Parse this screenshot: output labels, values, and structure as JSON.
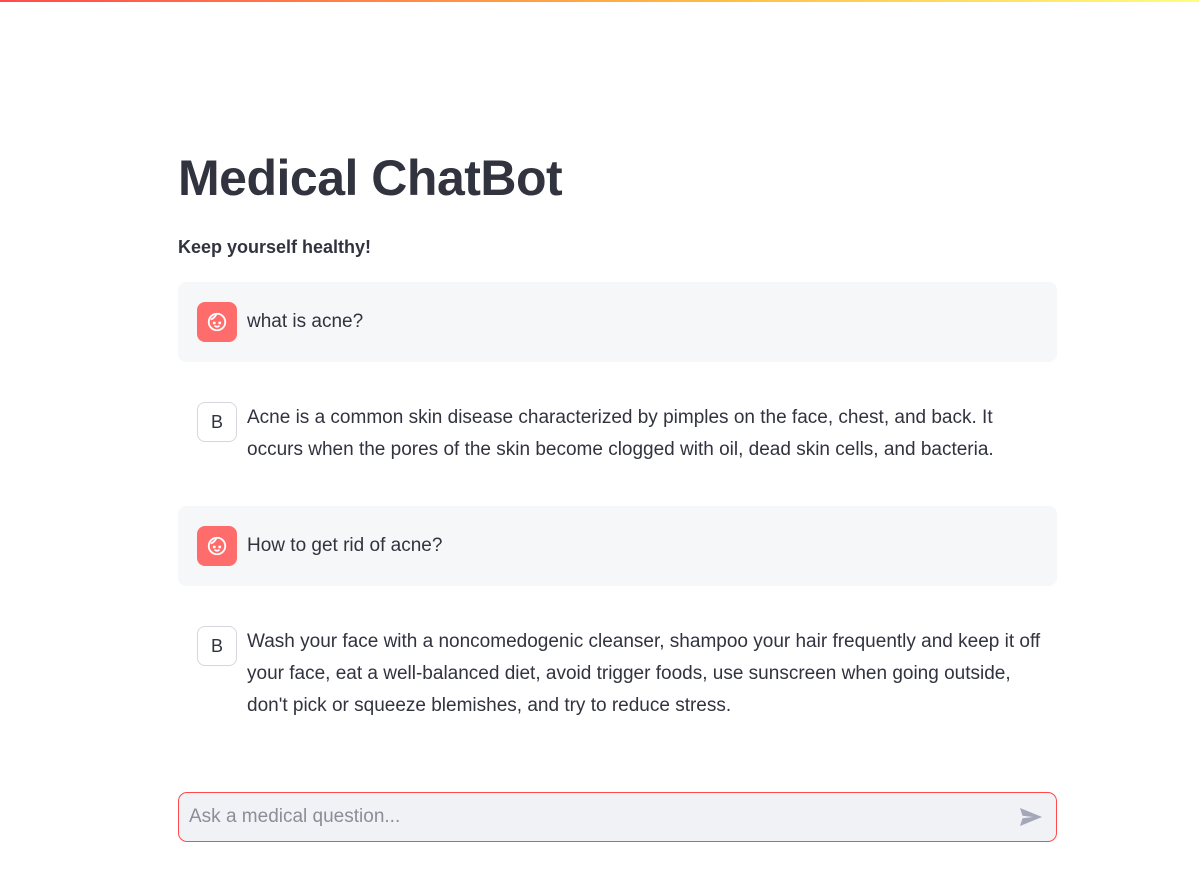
{
  "app": {
    "title": "Medical ChatBot",
    "subtitle": "Keep yourself healthy!"
  },
  "messages": [
    {
      "role": "user",
      "avatar_icon": "face-icon",
      "text": "what is acne?"
    },
    {
      "role": "bot",
      "avatar_letter": "B",
      "text": "Acne is a common skin disease characterized by pimples on the face, chest, and back. It occurs when the pores of the skin become clogged with oil, dead skin cells, and bacteria."
    },
    {
      "role": "user",
      "avatar_icon": "face-icon",
      "text": "How to get rid of acne?"
    },
    {
      "role": "bot",
      "avatar_letter": "B",
      "text": "Wash your face with a noncomedogenic cleanser, shampoo your hair frequently and keep it off your face, eat a well-balanced diet, avoid trigger foods, use sunscreen when going outside, don't pick or squeeze blemishes, and try to reduce stress."
    }
  ],
  "chat_input": {
    "placeholder": "Ask a medical question...",
    "value": "",
    "send_icon": "send-icon"
  },
  "colors": {
    "accent": "#ff4b4b",
    "user_avatar": "#ff6c6c",
    "user_bubble": "#f6f7f9",
    "text": "#31333f"
  }
}
